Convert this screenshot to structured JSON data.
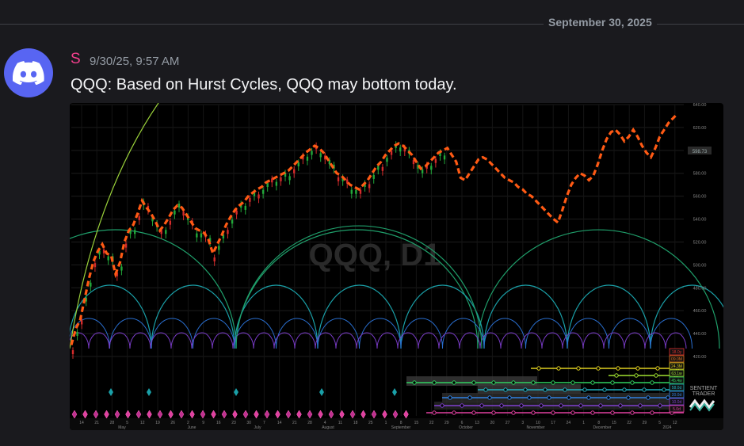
{
  "date_divider": "September 30, 2025",
  "message": {
    "author": "S",
    "timestamp": "9/30/25, 9:57 AM",
    "text": "QQQ: Based on Hurst Cycles, QQQ may bottom today.",
    "author_color": "#f23f8c"
  },
  "chart": {
    "watermark": "QQQ, D1",
    "brand_line1": "SENTIENT",
    "brand_line2": "TRADER",
    "price_tag": "598.73",
    "y_ticks": [
      "640.00",
      "620.00",
      "600.00",
      "580.00",
      "560.00",
      "540.00",
      "520.00",
      "500.00",
      "480.00",
      "460.00",
      "440.00",
      "420.00"
    ],
    "cycle_labels": [
      "18.0y",
      "09.0M",
      "24.3M",
      "63.1w",
      "45.4w",
      "58.0d",
      "20.0d",
      "10.0d",
      "5.0d"
    ],
    "cycle_label_colors": [
      "#e03030",
      "#e07020",
      "#e0d020",
      "#a0e030",
      "#30d060",
      "#20b0c0",
      "#3080e0",
      "#8040d0",
      "#e040a0"
    ],
    "x_ticks": [
      "14",
      "21",
      "28",
      "5",
      "12",
      "19",
      "26",
      "2",
      "9",
      "16",
      "23",
      "30",
      "7",
      "14",
      "21",
      "28",
      "4",
      "11",
      "18",
      "25",
      "1",
      "8",
      "15",
      "22",
      "29",
      "6",
      "13",
      "20",
      "27",
      "3",
      "10",
      "17",
      "24",
      "1",
      "8",
      "15",
      "22",
      "29",
      "5",
      "12"
    ],
    "month_labels": [
      "May",
      "June",
      "July",
      "August",
      "September",
      "October",
      "November",
      "December",
      "2024"
    ]
  },
  "chart_data": {
    "type": "line",
    "title": "QQQ, D1",
    "ylabel": "",
    "ylim": [
      420,
      640
    ],
    "series": [
      {
        "values": [
          430,
          444,
          452,
          470,
          488,
          503,
          512,
          518,
          510,
          508,
          492,
          502,
          520,
          530,
          535,
          545,
          556,
          550,
          545,
          538,
          530,
          535,
          541,
          548,
          552,
          550,
          544,
          538,
          532,
          530,
          528,
          522,
          510,
          518,
          526,
          535,
          542,
          548,
          552,
          555,
          560,
          563,
          566,
          568,
          572,
          574,
          576,
          578,
          580,
          582,
          586,
          590,
          594,
          598,
          601,
          604,
          602,
          598,
          592,
          586,
          580,
          578,
          574,
          570,
          568,
          566,
          570,
          574,
          580,
          586,
          590,
          596,
          600,
          604,
          606,
          604,
          600,
          596,
          590,
          584,
          586,
          590,
          594,
          598,
          600,
          602,
          596,
          590,
          576,
          574,
          580,
          586,
          592,
          594,
          592,
          588,
          584,
          580,
          576,
          574,
          572,
          568,
          566,
          562,
          560,
          556,
          552,
          548,
          544,
          540,
          537,
          548,
          560,
          570,
          576,
          580,
          578,
          574,
          578,
          588,
          600,
          610,
          616,
          618,
          614,
          608,
          612,
          618,
          612,
          604,
          598,
          594,
          602,
          612,
          618,
          624,
          628,
          632
        ]
      }
    ]
  }
}
